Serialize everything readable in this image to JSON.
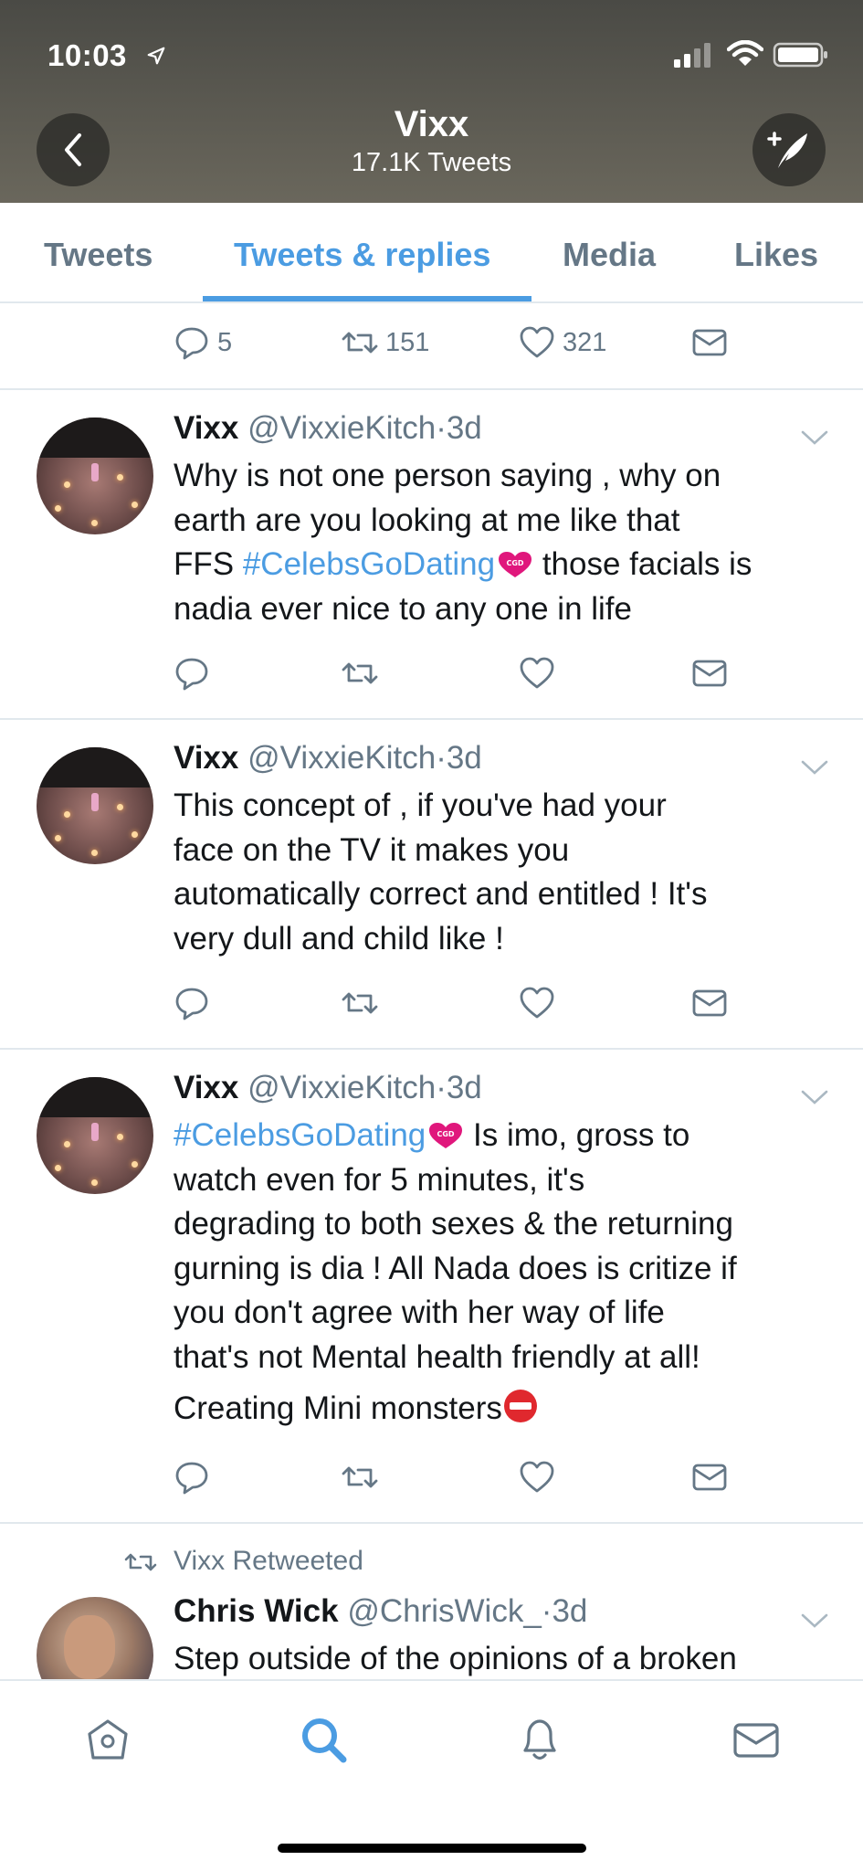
{
  "status_bar": {
    "time": "10:03"
  },
  "header": {
    "name": "Vixx",
    "tweet_count": "17.1K Tweets"
  },
  "tabs": [
    {
      "label": "Tweets",
      "active": false
    },
    {
      "label": "Tweets & replies",
      "active": true
    },
    {
      "label": "Media",
      "active": false
    },
    {
      "label": "Likes",
      "active": false
    }
  ],
  "top_actions": {
    "replies": "5",
    "retweets": "151",
    "likes": "321"
  },
  "tweets": [
    {
      "name": "Vixx",
      "handle": "@VixxieKitch",
      "time": "3d",
      "lines": [
        "Why is not one person saying , why on",
        "earth are you looking at me like that"
      ],
      "line3_pre": "FFS ",
      "line3_hash": "#CelebsGoDating",
      "line3_post": " those facials is",
      "line4": "nadia ever nice to any one in life"
    },
    {
      "name": "Vixx",
      "handle": "@VixxieKitch",
      "time": "3d",
      "lines": [
        "This concept of ,  if you've had your",
        "face on the TV it makes you",
        "automatically correct and entitled  ! It's",
        "very dull and child like !"
      ]
    },
    {
      "name": "Vixx",
      "handle": "@VixxieKitch",
      "time": "3d",
      "line1_hash": "#CelebsGoDating",
      "line1_post": " Is imo,  gross to",
      "lines": [
        "watch even for 5 minutes,  it's",
        "degrading to both sexes & the returning",
        "gurning is dia ! All Nada does is critize if",
        "you don't agree with her way of life",
        "that's not Mental health friendly at all!",
        "Creating Mini monsters"
      ]
    }
  ],
  "retweet": {
    "label": "Vixx Retweeted",
    "name": "Chris Wick",
    "handle": "@ChrisWick_",
    "time": "3d",
    "text": "Step outside of the opinions of a broken"
  },
  "icons": {
    "reply": "reply-icon",
    "retweet": "retweet-icon",
    "like": "heart-icon",
    "dm": "envelope-icon",
    "home": "home-icon",
    "search": "search-icon",
    "notifications": "bell-icon",
    "messages": "mail-icon"
  },
  "colors": {
    "accent": "#4b9ce2",
    "secondary_text": "#657786",
    "hashtag_emoji": "#e0177c"
  }
}
